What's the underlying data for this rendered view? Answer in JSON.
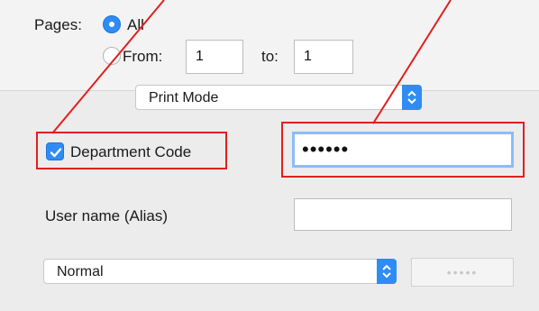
{
  "pages": {
    "label": "Pages:",
    "all_label": "All",
    "from_label": "From:",
    "from_value": "1",
    "to_label": "to:",
    "to_value": "1"
  },
  "print_mode": {
    "selected": "Print Mode"
  },
  "department_code": {
    "label": "Department Code",
    "checked": true,
    "password_value": "••••••"
  },
  "user_name": {
    "label": "User name (Alias)",
    "value": ""
  },
  "mode": {
    "selected": "Normal",
    "password_placeholder": "•••••"
  },
  "colors": {
    "accent": "#2f8cf4",
    "annotation": "#e0201e"
  }
}
